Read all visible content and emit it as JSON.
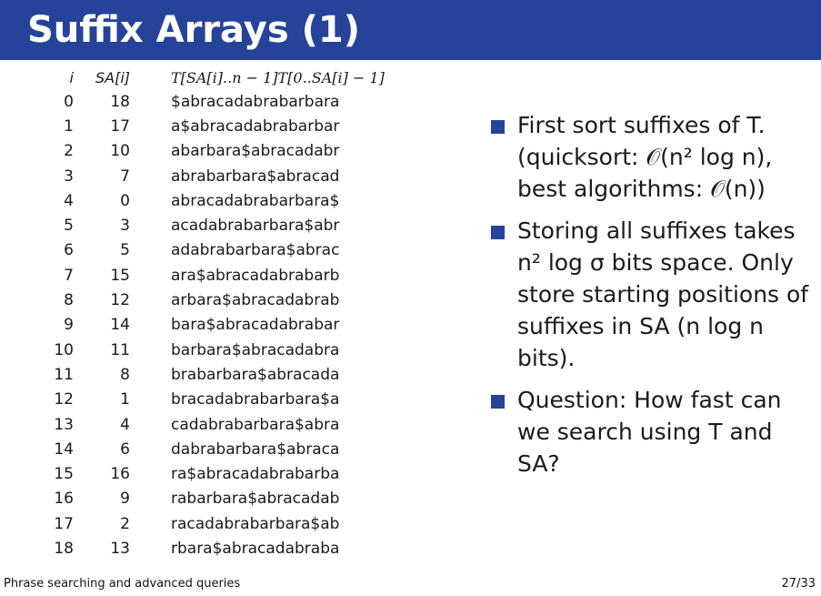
{
  "slide": {
    "title": "Suffix Arrays (1)"
  },
  "table": {
    "headers": {
      "i": "i",
      "sa": "SA[i]",
      "suffix": "T[SA[i]..n − 1]T[0..SA[i] − 1]"
    },
    "rows": [
      {
        "i": "0",
        "sa": "18",
        "suffix": "$abracadabrabarbara"
      },
      {
        "i": "1",
        "sa": "17",
        "suffix": "a$abracadabrabarbar"
      },
      {
        "i": "2",
        "sa": "10",
        "suffix": "abarbara$abracadabr"
      },
      {
        "i": "3",
        "sa": "7",
        "suffix": "abrabarbara$abracad"
      },
      {
        "i": "4",
        "sa": "0",
        "suffix": "abracadabrabarbara$"
      },
      {
        "i": "5",
        "sa": "3",
        "suffix": "acadabrabarbara$abr"
      },
      {
        "i": "6",
        "sa": "5",
        "suffix": "adabrabarbara$abrac"
      },
      {
        "i": "7",
        "sa": "15",
        "suffix": "ara$abracadabrabarb"
      },
      {
        "i": "8",
        "sa": "12",
        "suffix": "arbara$abracadabrab"
      },
      {
        "i": "9",
        "sa": "14",
        "suffix": "bara$abracadabrabar"
      },
      {
        "i": "10",
        "sa": "11",
        "suffix": "barbara$abracadabra"
      },
      {
        "i": "11",
        "sa": "8",
        "suffix": "brabarbara$abracada"
      },
      {
        "i": "12",
        "sa": "1",
        "suffix": "bracadabrabarbara$a"
      },
      {
        "i": "13",
        "sa": "4",
        "suffix": "cadabrabarbara$abra"
      },
      {
        "i": "14",
        "sa": "6",
        "suffix": "dabrabarbara$abraca"
      },
      {
        "i": "15",
        "sa": "16",
        "suffix": "ra$abracadabrabarba"
      },
      {
        "i": "16",
        "sa": "9",
        "suffix": "rabarbara$abracadab"
      },
      {
        "i": "17",
        "sa": "2",
        "suffix": "racadabrabarbara$ab"
      },
      {
        "i": "18",
        "sa": "13",
        "suffix": "rbara$abracadabraba"
      }
    ]
  },
  "bullets": [
    "First sort suffixes of T. (quicksort: 𝒪(n² log n), best algorithms: 𝒪(n))",
    "Storing all suffixes takes n² log σ bits space. Only store starting positions of suffixes in SA (n log n bits).",
    "Question: How fast can we search using T and SA?"
  ],
  "footer": {
    "left": "Phrase searching and advanced queries",
    "right": "27/33"
  },
  "colors": {
    "title_bar": "#26439a",
    "bullet_marker": "#26439a"
  }
}
